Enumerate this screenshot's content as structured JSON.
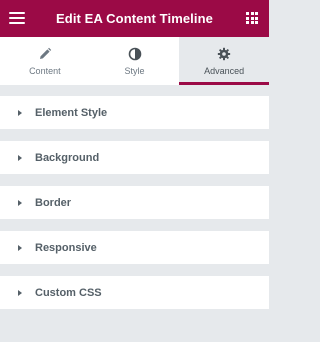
{
  "header": {
    "title": "Edit EA Content Timeline",
    "menu_icon": "hamburger-icon",
    "apps_icon": "grid-icon",
    "background": "#9b0a46"
  },
  "tabs": [
    {
      "label": "Content",
      "icon": "pencil-icon",
      "active": false
    },
    {
      "label": "Style",
      "icon": "half-circle-icon",
      "active": false
    },
    {
      "label": "Advanced",
      "icon": "gear-icon",
      "active": true
    }
  ],
  "sections": [
    {
      "label": "Element Style"
    },
    {
      "label": "Background"
    },
    {
      "label": "Border"
    },
    {
      "label": "Responsive"
    },
    {
      "label": "Custom CSS"
    }
  ],
  "colors": {
    "accent": "#9b0a46",
    "panel_bg": "#e6e9ec",
    "text": "#556068"
  }
}
